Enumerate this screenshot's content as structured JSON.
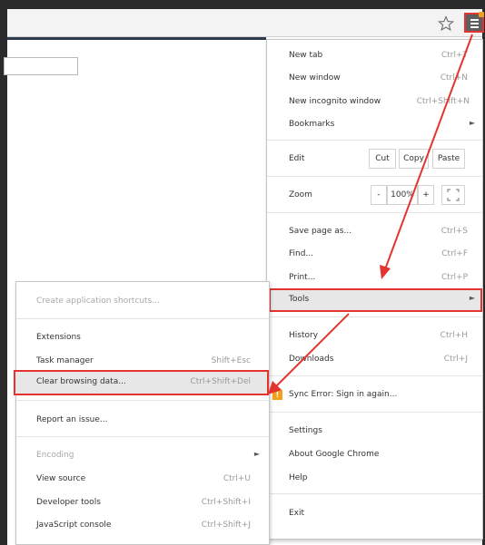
{
  "colors": {
    "highlight_red": "#e3342f",
    "badge_orange": "#f2a11a",
    "menu_button": "#5e5e5e"
  },
  "toolbar": {
    "star_icon": "star-icon",
    "menu_icon": "hamburger-menu-icon"
  },
  "main_menu": {
    "new_tab": {
      "label": "New tab",
      "shortcut": "Ctrl+T"
    },
    "new_window": {
      "label": "New window",
      "shortcut": "Ctrl+N"
    },
    "new_incognito": {
      "label": "New incognito window",
      "shortcut": "Ctrl+Shift+N"
    },
    "bookmarks": {
      "label": "Bookmarks"
    },
    "edit": {
      "label": "Edit",
      "cut": "Cut",
      "copy": "Copy",
      "paste": "Paste"
    },
    "zoom": {
      "label": "Zoom",
      "minus": "-",
      "level": "100%",
      "plus": "+"
    },
    "save_page": {
      "label": "Save page as...",
      "shortcut": "Ctrl+S"
    },
    "find": {
      "label": "Find...",
      "shortcut": "Ctrl+F"
    },
    "print": {
      "label": "Print...",
      "shortcut": "Ctrl+P"
    },
    "tools": {
      "label": "Tools"
    },
    "history": {
      "label": "History",
      "shortcut": "Ctrl+H"
    },
    "downloads": {
      "label": "Downloads",
      "shortcut": "Ctrl+J"
    },
    "sync_error": {
      "label": "Sync Error: Sign in again...",
      "icon": "!"
    },
    "settings": {
      "label": "Settings"
    },
    "about": {
      "label": "About Google Chrome"
    },
    "help": {
      "label": "Help"
    },
    "exit": {
      "label": "Exit"
    }
  },
  "tools_menu": {
    "create_shortcuts": {
      "label": "Create application shortcuts..."
    },
    "extensions": {
      "label": "Extensions"
    },
    "task_manager": {
      "label": "Task manager",
      "shortcut": "Shift+Esc"
    },
    "clear_browsing": {
      "label": "Clear browsing data...",
      "shortcut": "Ctrl+Shift+Del"
    },
    "report_issue": {
      "label": "Report an issue..."
    },
    "encoding": {
      "label": "Encoding"
    },
    "view_source": {
      "label": "View source",
      "shortcut": "Ctrl+U"
    },
    "developer_tools": {
      "label": "Developer tools",
      "shortcut": "Ctrl+Shift+I"
    },
    "js_console": {
      "label": "JavaScript console",
      "shortcut": "Ctrl+Shift+J"
    }
  }
}
